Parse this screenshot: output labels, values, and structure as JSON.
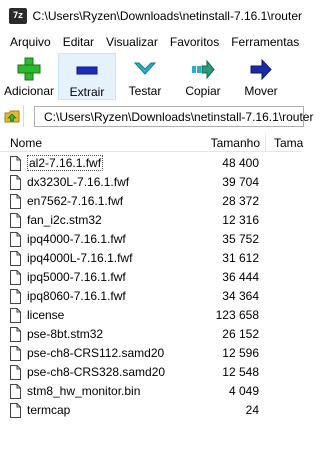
{
  "window": {
    "app_icon_text": "7z",
    "title": "C:\\Users\\Ryzen\\Downloads\\netinstall-7.16.1\\router"
  },
  "menu": [
    "Arquivo",
    "Editar",
    "Visualizar",
    "Favoritos",
    "Ferramentas"
  ],
  "toolbar": {
    "buttons": [
      {
        "label": "Adicionar",
        "icon": "plus-icon",
        "color": "#2db82d"
      },
      {
        "label": "Extrair",
        "icon": "minus-icon",
        "color": "#1a2dbd",
        "active": true
      },
      {
        "label": "Testar",
        "icon": "check-icon",
        "color": "#2ab0c8"
      },
      {
        "label": "Copiar",
        "icon": "copy-arrow-icon",
        "color": "#2a9a7a"
      },
      {
        "label": "Mover",
        "icon": "move-arrow-icon",
        "color": "#1a2aa8"
      }
    ]
  },
  "address": {
    "path": "C:\\Users\\Ryzen\\Downloads\\netinstall-7.16.1\\router"
  },
  "columns": {
    "name": "Nome",
    "size": "Tamanho",
    "type": "Tama"
  },
  "files": [
    {
      "name": "al2-7.16.1.fwf",
      "size": "48 400"
    },
    {
      "name": "dx3230L-7.16.1.fwf",
      "size": "39 704"
    },
    {
      "name": "en7562-7.16.1.fwf",
      "size": "28 372"
    },
    {
      "name": "fan_i2c.stm32",
      "size": "12 316"
    },
    {
      "name": "ipq4000-7.16.1.fwf",
      "size": "35 752"
    },
    {
      "name": "ipq4000L-7.16.1.fwf",
      "size": "31 612"
    },
    {
      "name": "ipq5000-7.16.1.fwf",
      "size": "36 444"
    },
    {
      "name": "ipq8060-7.16.1.fwf",
      "size": "34 364"
    },
    {
      "name": "license",
      "size": "123 658"
    },
    {
      "name": "pse-8bt.stm32",
      "size": "26 152"
    },
    {
      "name": "pse-ch8-CRS112.samd20",
      "size": "12 596"
    },
    {
      "name": "pse-ch8-CRS328.samd20",
      "size": "12 548"
    },
    {
      "name": "stm8_hw_monitor.bin",
      "size": "4 049"
    },
    {
      "name": "termcap",
      "size": "24"
    }
  ]
}
